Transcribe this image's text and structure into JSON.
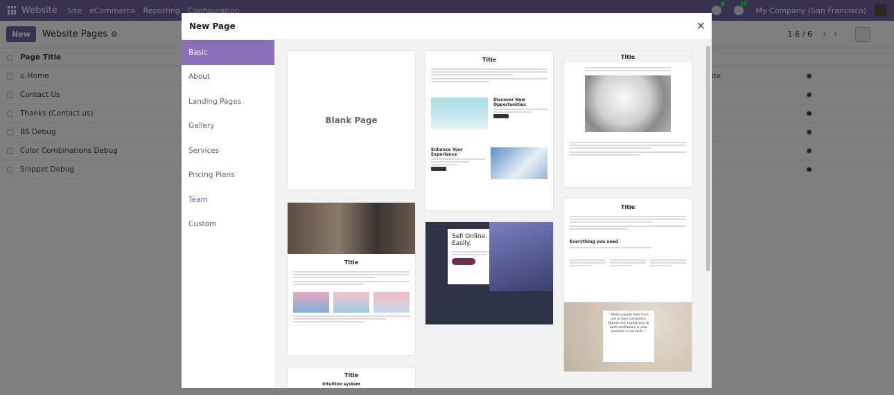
{
  "navbar": {
    "brand": "Website",
    "menu": [
      "Site",
      "eCommerce",
      "Reporting",
      "Configuration"
    ],
    "chat_count": "6",
    "activity_count": "17",
    "company": "My Company (San Francisco)"
  },
  "control": {
    "new_label": "New",
    "title": "Website Pages",
    "pager": "1-6 / 6"
  },
  "list": {
    "header": "Page Title",
    "rows": [
      "Home",
      "Contact Us",
      "Thanks (Contact us)",
      "BS Debug",
      "Color Combinations Debug",
      "Snippet Debug"
    ],
    "partial_col": "ite"
  },
  "modal": {
    "title": "New Page",
    "categories": [
      "Basic",
      "About",
      "Landing Pages",
      "Gallery",
      "Services",
      "Pricing Plans",
      "Team",
      "Custom"
    ],
    "active_category": "Basic",
    "templates": {
      "blank_label": "Blank Page",
      "title_label": "Title",
      "discover_heading": "Discover New Opportunities",
      "enhance_heading": "Enhance Your Experience",
      "sell_heading": "Sell Online. Easily.",
      "everything_heading": "Everything you need",
      "quote_text": "\" Write a quote here from one of your customers. Quotes are a great way to build confidence in your products or services. \"",
      "intuitive_heading": "Intuitive system",
      "learn_more": "Learn more",
      "contact_us": "Contact us"
    }
  },
  "colors": {
    "navbar": "#71639e",
    "active_category": "#8b6fb8",
    "accent_link": "#6b5c8f"
  }
}
